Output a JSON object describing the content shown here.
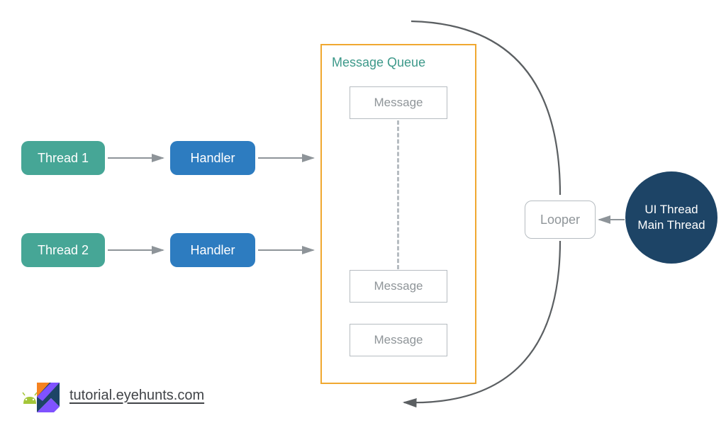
{
  "threads": {
    "thread1": "Thread 1",
    "thread2": "Thread 2"
  },
  "handlers": {
    "handler1": "Handler",
    "handler2": "Handler"
  },
  "queue": {
    "title": "Message Queue",
    "messages": {
      "msg1": "Message",
      "msg2": "Message",
      "msg3": "Message"
    }
  },
  "looper": "Looper",
  "uiThread": {
    "line1": "UI Thread",
    "line2": "Main Thread"
  },
  "footer": {
    "link": "tutorial.eyehunts.com"
  },
  "colors": {
    "thread": "#46a696",
    "handler": "#2d7cc0",
    "queueBorder": "#f0a830",
    "messageBorder": "#b6bcc1",
    "messageText": "#8f9599",
    "uiThread": "#1d4466",
    "arrow": "#8e9499",
    "looperArc": "#5b5f62"
  }
}
